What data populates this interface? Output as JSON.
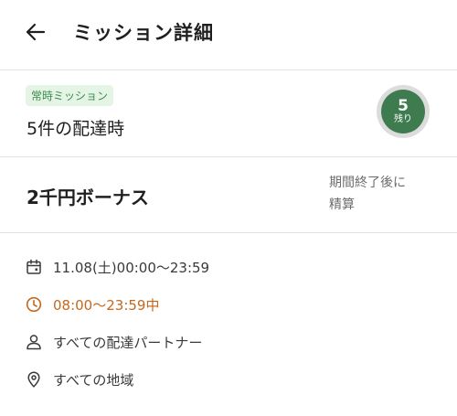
{
  "header": {
    "back_icon": "arrow-left-icon",
    "title": "ミッション詳細"
  },
  "mission": {
    "badge": "常時ミッション",
    "name": "5件の配達時",
    "remaining_count": "5",
    "remaining_label": "残り",
    "accent_color": "#3e7b4f"
  },
  "reward": {
    "title": "2千円ボーナス",
    "settlement_line1": "期間終了後に",
    "settlement_line2": "精算"
  },
  "details": {
    "date": {
      "icon": "calendar-icon",
      "text": "11.08(土)00:00～23:59"
    },
    "time": {
      "icon": "clock-icon",
      "text": "08:00～23:59中",
      "color": "#c5671d"
    },
    "partner": {
      "icon": "person-icon",
      "text": "すべての配達パートナー"
    },
    "area": {
      "icon": "location-pin-icon",
      "text": "すべての地域"
    }
  }
}
